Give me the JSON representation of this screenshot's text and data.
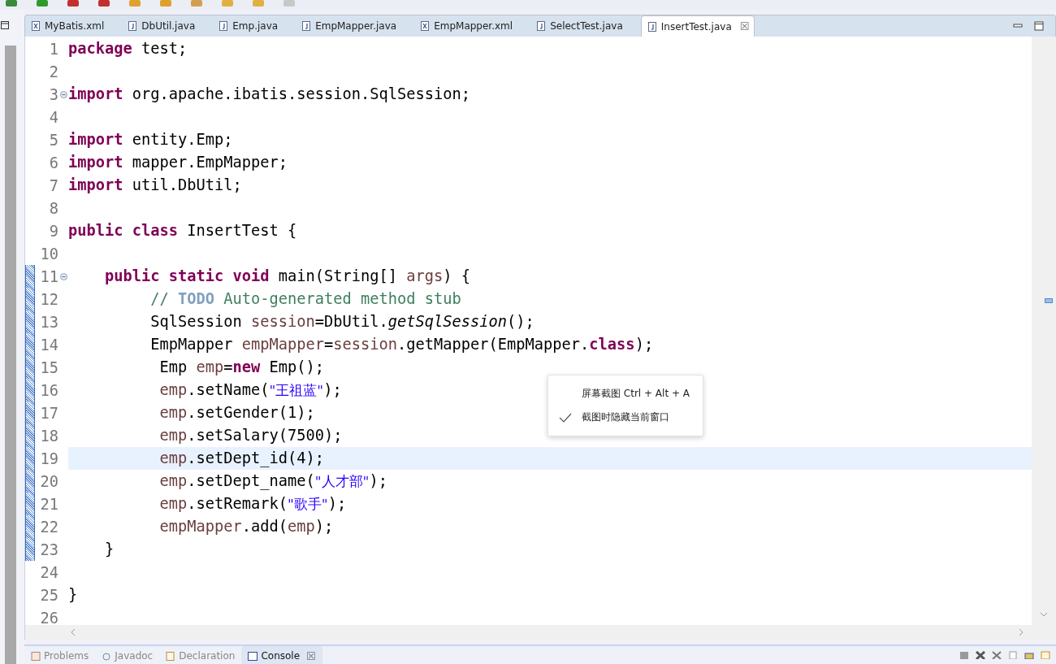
{
  "editor_tabs": [
    {
      "label": "MyBatis.xml",
      "kind": "xml",
      "selected": false
    },
    {
      "label": "DbUtil.java",
      "kind": "java",
      "selected": false
    },
    {
      "label": "Emp.java",
      "kind": "java",
      "selected": false
    },
    {
      "label": "EmpMapper.java",
      "kind": "java",
      "selected": false
    },
    {
      "label": "EmpMapper.xml",
      "kind": "xml",
      "selected": false
    },
    {
      "label": "SelectTest.java",
      "kind": "java",
      "selected": false
    },
    {
      "label": "InsertTest.java",
      "kind": "java",
      "selected": true
    }
  ],
  "close_glyph": "☒",
  "lines": [
    {
      "n": "1",
      "highlighted": false,
      "foldable": false,
      "changed": false,
      "tokens": [
        {
          "kind": "kw",
          "text": "package"
        },
        {
          "kind": "plain",
          "text": " test;"
        }
      ]
    },
    {
      "n": "2",
      "highlighted": false,
      "foldable": false,
      "changed": false
    },
    {
      "n": "3",
      "highlighted": false,
      "foldable": true,
      "changed": false,
      "tokens": [
        {
          "kind": "kw",
          "text": "import"
        },
        {
          "kind": "plain",
          "text": " org.apache.ibatis.session.SqlSession;"
        }
      ]
    },
    {
      "n": "4",
      "highlighted": false,
      "foldable": false,
      "changed": false
    },
    {
      "n": "5",
      "highlighted": false,
      "foldable": false,
      "changed": false,
      "tokens": [
        {
          "kind": "kw",
          "text": "import"
        },
        {
          "kind": "plain",
          "text": " entity.Emp;"
        }
      ]
    },
    {
      "n": "6",
      "highlighted": false,
      "foldable": false,
      "changed": false,
      "tokens": [
        {
          "kind": "kw",
          "text": "import"
        },
        {
          "kind": "plain",
          "text": " mapper.EmpMapper;"
        }
      ]
    },
    {
      "n": "7",
      "highlighted": false,
      "foldable": false,
      "changed": false,
      "tokens": [
        {
          "kind": "kw",
          "text": "import"
        },
        {
          "kind": "plain",
          "text": " util.DbUtil;"
        }
      ]
    },
    {
      "n": "8",
      "highlighted": false,
      "foldable": false,
      "changed": false
    },
    {
      "n": "9",
      "highlighted": false,
      "foldable": false,
      "changed": false,
      "tokens": [
        {
          "kind": "kw",
          "text": "public class"
        },
        {
          "kind": "plain",
          "text": " InsertTest {"
        }
      ]
    },
    {
      "n": "10",
      "highlighted": false,
      "foldable": false,
      "changed": false
    },
    {
      "n": "11",
      "highlighted": false,
      "foldable": true,
      "changed": true,
      "tokens": [
        {
          "kind": "kw",
          "text": "    public static void"
        },
        {
          "kind": "plain",
          "text": " main(String[] "
        },
        {
          "kind": "var",
          "text": "args"
        },
        {
          "kind": "plain",
          "text": ") {"
        }
      ]
    },
    {
      "n": "12",
      "highlighted": false,
      "foldable": false,
      "changed": true,
      "tokens": [
        {
          "kind": "comment",
          "text": "         // "
        },
        {
          "kind": "todo",
          "text": "TODO"
        },
        {
          "kind": "comment",
          "text": " Auto-generated method stub"
        }
      ]
    },
    {
      "n": "13",
      "highlighted": false,
      "foldable": false,
      "changed": true,
      "tokens": [
        {
          "kind": "plain",
          "text": "         SqlSession "
        },
        {
          "kind": "var",
          "text": "session"
        },
        {
          "kind": "plain",
          "text": "=DbUtil."
        },
        {
          "kind": "static",
          "text": "getSqlSession"
        },
        {
          "kind": "plain",
          "text": "();"
        }
      ]
    },
    {
      "n": "14",
      "highlighted": false,
      "foldable": false,
      "changed": true,
      "tokens": [
        {
          "kind": "plain",
          "text": "         EmpMapper "
        },
        {
          "kind": "var",
          "text": "empMapper"
        },
        {
          "kind": "plain",
          "text": "="
        },
        {
          "kind": "var",
          "text": "session"
        },
        {
          "kind": "plain",
          "text": ".getMapper(EmpMapper."
        },
        {
          "kind": "kw",
          "text": "class"
        },
        {
          "kind": "plain",
          "text": ");"
        }
      ]
    },
    {
      "n": "15",
      "highlighted": false,
      "foldable": false,
      "changed": true,
      "tokens": [
        {
          "kind": "plain",
          "text": "          Emp "
        },
        {
          "kind": "var",
          "text": "emp"
        },
        {
          "kind": "plain",
          "text": "="
        },
        {
          "kind": "kw",
          "text": "new"
        },
        {
          "kind": "plain",
          "text": " Emp();"
        }
      ]
    },
    {
      "n": "16",
      "highlighted": false,
      "foldable": false,
      "changed": true,
      "tokens": [
        {
          "kind": "var",
          "text": "          emp"
        },
        {
          "kind": "plain",
          "text": ".setName("
        },
        {
          "kind": "str",
          "text": "\"王祖蓝\""
        },
        {
          "kind": "plain",
          "text": ");"
        }
      ]
    },
    {
      "n": "17",
      "highlighted": false,
      "foldable": false,
      "changed": true,
      "tokens": [
        {
          "kind": "var",
          "text": "          emp"
        },
        {
          "kind": "plain",
          "text": ".setGender(1);"
        }
      ]
    },
    {
      "n": "18",
      "highlighted": false,
      "foldable": false,
      "changed": true,
      "tokens": [
        {
          "kind": "var",
          "text": "          emp"
        },
        {
          "kind": "plain",
          "text": ".setSalary(7500);"
        }
      ]
    },
    {
      "n": "19",
      "highlighted": true,
      "foldable": false,
      "changed": true,
      "tokens": [
        {
          "kind": "var",
          "text": "          emp"
        },
        {
          "kind": "plain",
          "text": ".setDept_id(4);"
        }
      ]
    },
    {
      "n": "20",
      "highlighted": false,
      "foldable": false,
      "changed": true,
      "tokens": [
        {
          "kind": "var",
          "text": "          emp"
        },
        {
          "kind": "plain",
          "text": ".setDept_name("
        },
        {
          "kind": "str",
          "text": "\"人才部\""
        },
        {
          "kind": "plain",
          "text": ");"
        }
      ]
    },
    {
      "n": "21",
      "highlighted": false,
      "foldable": false,
      "changed": true,
      "tokens": [
        {
          "kind": "var",
          "text": "          emp"
        },
        {
          "kind": "plain",
          "text": ".setRemark("
        },
        {
          "kind": "str",
          "text": "\"歌手\""
        },
        {
          "kind": "plain",
          "text": ");"
        }
      ]
    },
    {
      "n": "22",
      "highlighted": false,
      "foldable": false,
      "changed": true,
      "tokens": [
        {
          "kind": "var",
          "text": "          empMapper"
        },
        {
          "kind": "plain",
          "text": ".add("
        },
        {
          "kind": "var",
          "text": "emp"
        },
        {
          "kind": "plain",
          "text": ");"
        }
      ]
    },
    {
      "n": "23",
      "highlighted": false,
      "foldable": false,
      "changed": true,
      "tokens": [
        {
          "kind": "plain",
          "text": "    }"
        }
      ]
    },
    {
      "n": "24",
      "highlighted": false,
      "foldable": false,
      "changed": false
    },
    {
      "n": "25",
      "highlighted": false,
      "foldable": false,
      "changed": false,
      "tokens": [
        {
          "kind": "plain",
          "text": "}"
        }
      ]
    },
    {
      "n": "26",
      "highlighted": false,
      "foldable": false,
      "changed": false
    }
  ],
  "context_menu": [
    {
      "label": "屏幕截图 Ctrl + Alt + A",
      "checked": false
    },
    {
      "label": "截图时隐藏当前窗口",
      "checked": true
    }
  ],
  "bottom_tabs": [
    {
      "label": "Problems",
      "kind": "problems",
      "selected": false
    },
    {
      "label": "Javadoc",
      "kind": "javadoc",
      "selected": false
    },
    {
      "label": "Declaration",
      "kind": "declaration",
      "selected": false
    },
    {
      "label": "Console",
      "kind": "console",
      "selected": true
    }
  ]
}
